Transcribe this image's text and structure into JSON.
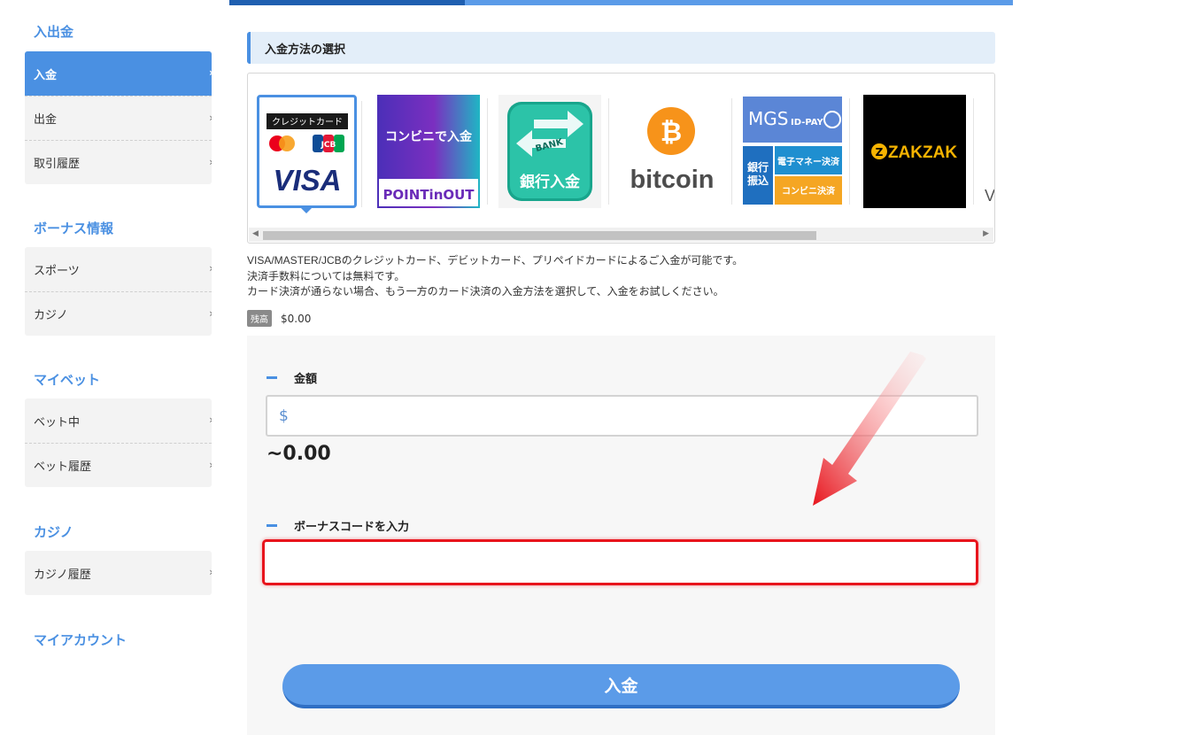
{
  "sidebar": {
    "sections": [
      {
        "title": "入出金",
        "items": [
          {
            "label": "入金",
            "active": true
          },
          {
            "label": "出金"
          },
          {
            "label": "取引履歴"
          }
        ]
      },
      {
        "title": "ボーナス情報",
        "items": [
          {
            "label": "スポーツ"
          },
          {
            "label": "カジノ"
          }
        ]
      },
      {
        "title": "マイベット",
        "items": [
          {
            "label": "ベット中"
          },
          {
            "label": "ベット履歴"
          }
        ]
      },
      {
        "title": "カジノ",
        "items": [
          {
            "label": "カジノ履歴"
          }
        ]
      },
      {
        "title": "マイアカウント",
        "items": []
      }
    ],
    "arrow_glyph": "›"
  },
  "progress": {
    "completed_fraction": 0.3
  },
  "payment": {
    "header": "入金方法の選択",
    "methods": [
      {
        "id": "card",
        "top_label": "クレジットカード",
        "brands": [
          "JCB",
          "VISA"
        ],
        "selected": true
      },
      {
        "id": "conveni",
        "top_label": "コンビニで入金",
        "bottom_label": "POINTinOUT"
      },
      {
        "id": "bank",
        "badge": "BANK",
        "label": "銀行入金"
      },
      {
        "id": "bitcoin",
        "symbol": "₿",
        "label": "bitcoin"
      },
      {
        "id": "mgs",
        "top_label": "MGS",
        "top_sub": "ID-PAY",
        "left_label": "銀行\n振込",
        "right_top": "電子マネー決済",
        "right_bottom": "コンビニ決済"
      },
      {
        "id": "zakzak",
        "label": "ZAKZAK",
        "logo_letter": "Z"
      },
      {
        "id": "more",
        "label": "V"
      }
    ],
    "scroll": {
      "left": "◀",
      "right": "▶"
    },
    "description": [
      "VISA/MASTER/JCBのクレジットカード、デビットカード、プリペイドカードによるご入金が可能です。",
      "決済手数料については無料です。",
      "カード決済が通らない場合、もう一方のカード決済の入金方法を選択して、入金をお試しください。"
    ],
    "balance": {
      "label": "残高",
      "value": "$0.00"
    }
  },
  "form": {
    "amount": {
      "label": "金額",
      "currency": "$",
      "value": "",
      "placeholder": "",
      "converted": "~0.00"
    },
    "bonus": {
      "label": "ボーナスコードを入力",
      "value": "",
      "placeholder": ""
    },
    "submit_label": "入金"
  },
  "colors": {
    "accent": "#4a90e2",
    "highlight": "#e8141c"
  }
}
